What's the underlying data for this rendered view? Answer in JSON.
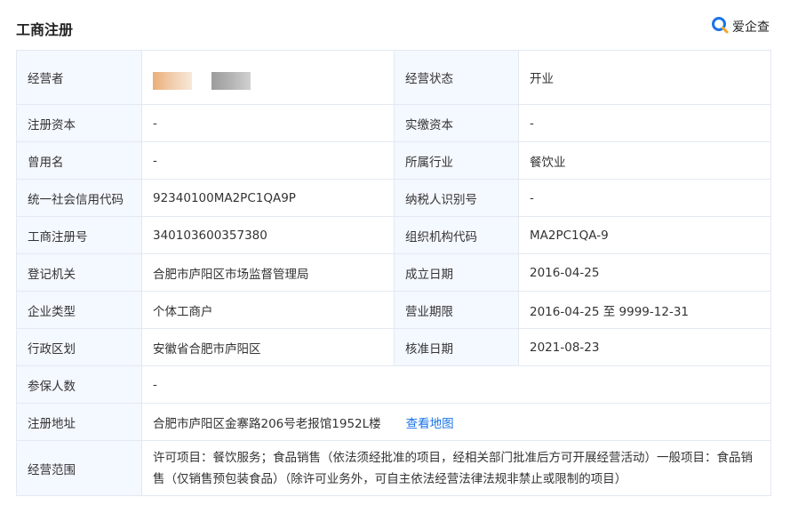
{
  "header": {
    "title": "工商注册",
    "brand_text": "爱企查"
  },
  "rows": {
    "r1": {
      "l1": "经营者",
      "v1": "",
      "l2": "经营状态",
      "v2": "开业"
    },
    "r2": {
      "l1": "注册资本",
      "v1": "-",
      "l2": "实缴资本",
      "v2": "-"
    },
    "r3": {
      "l1": "曾用名",
      "v1": "-",
      "l2": "所属行业",
      "v2": "餐饮业"
    },
    "r4": {
      "l1": "统一社会信用代码",
      "v1": "92340100MA2PC1QA9P",
      "l2": "纳税人识别号",
      "v2": "-"
    },
    "r5": {
      "l1": "工商注册号",
      "v1": "340103600357380",
      "l2": "组织机构代码",
      "v2": "MA2PC1QA-9"
    },
    "r6": {
      "l1": "登记机关",
      "v1": "合肥市庐阳区市场监督管理局",
      "l2": "成立日期",
      "v2": "2016-04-25"
    },
    "r7": {
      "l1": "企业类型",
      "v1": "个体工商户",
      "l2": "营业期限",
      "v2": "2016-04-25 至 9999-12-31"
    },
    "r8": {
      "l1": "行政区划",
      "v1": "安徽省合肥市庐阳区",
      "l2": "核准日期",
      "v2": "2021-08-23"
    },
    "r9": {
      "l1": "参保人数",
      "v1": "-"
    },
    "r10": {
      "l1": "注册地址",
      "v1": "合肥市庐阳区金寨路206号老报馆1952L楼",
      "link": "查看地图"
    },
    "r11": {
      "l1": "经营范围",
      "v1": "许可项目：餐饮服务；食品销售（依法须经批准的项目，经相关部门批准后方可开展经营活动）一般项目：食品销售（仅销售预包装食品）（除许可业务外，可自主依法经营法律法规非禁止或限制的项目）"
    }
  },
  "colors": {
    "label_bg": "#f4f8ff",
    "border": "#e3e9f2",
    "link": "#1a73e8",
    "brand_blue": "#1a73e8",
    "brand_orange": "#f5a623"
  }
}
